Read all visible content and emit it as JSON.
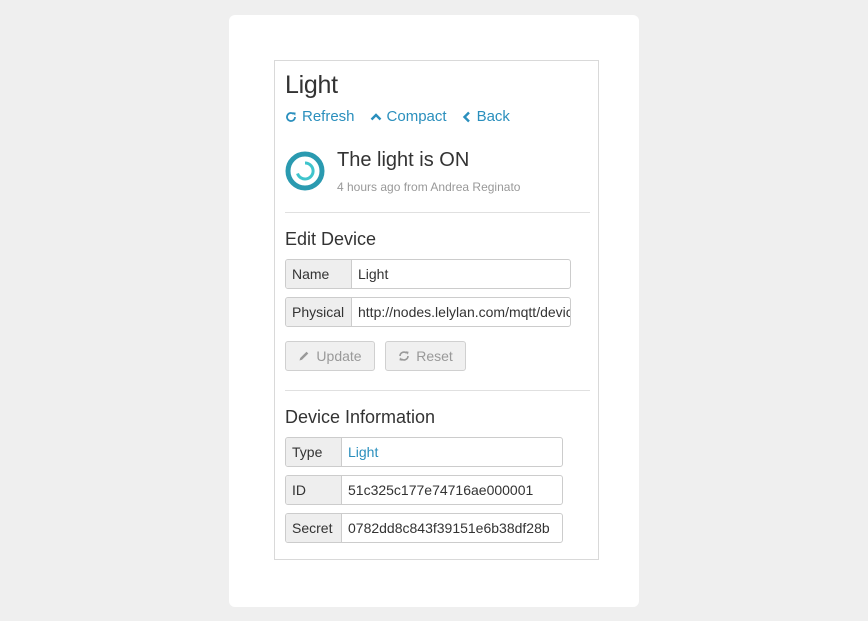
{
  "device": {
    "title": "Light",
    "actions": [
      {
        "label": "Refresh",
        "icon": "refresh-icon"
      },
      {
        "label": "Compact",
        "icon": "chevron-up-icon"
      },
      {
        "label": "Back",
        "icon": "chevron-left-icon"
      }
    ],
    "status": {
      "text": "The light is ON",
      "meta": "4 hours ago from Andrea Reginato",
      "icon": "power-status-icon",
      "icon_color": "#2a9ab0"
    }
  },
  "edit": {
    "heading": "Edit Device",
    "name_label": "Name",
    "name_value": "Light",
    "physical_label": "Physical",
    "physical_value": "http://nodes.lelylan.com/mqtt/devices/",
    "update_label": "Update",
    "reset_label": "Reset"
  },
  "info": {
    "heading": "Device Information",
    "type_label": "Type",
    "type_value": "Light",
    "id_label": "ID",
    "id_value": "51c325c177e74716ae000001",
    "secret_label": "Secret",
    "secret_value": "0782dd8c843f39151e6b38df28b"
  },
  "colors": {
    "accent": "#2a8fbd",
    "background": "#efefef"
  }
}
